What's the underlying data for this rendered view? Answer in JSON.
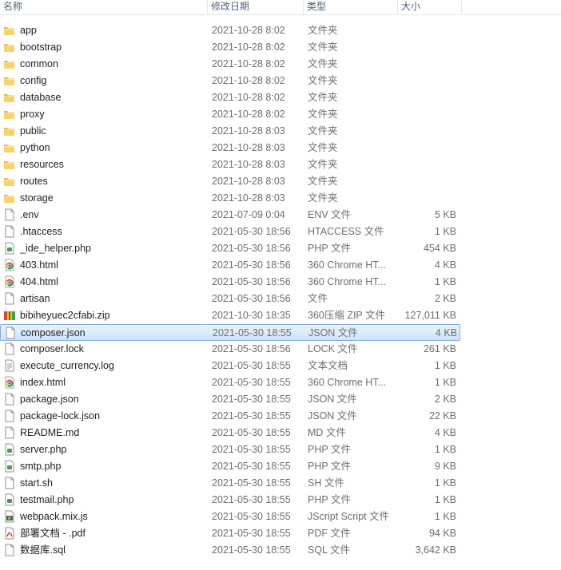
{
  "columns": {
    "name": "名称",
    "date": "修改日期",
    "type": "类型",
    "size": "大小"
  },
  "selected_index": 18,
  "files": [
    {
      "name": "app",
      "date": "2021-10-28 8:02",
      "type": "文件夹",
      "size": "",
      "icon": "folder-icon"
    },
    {
      "name": "bootstrap",
      "date": "2021-10-28 8:02",
      "type": "文件夹",
      "size": "",
      "icon": "folder-icon"
    },
    {
      "name": "common",
      "date": "2021-10-28 8:02",
      "type": "文件夹",
      "size": "",
      "icon": "folder-icon"
    },
    {
      "name": "config",
      "date": "2021-10-28 8:02",
      "type": "文件夹",
      "size": "",
      "icon": "folder-icon"
    },
    {
      "name": "database",
      "date": "2021-10-28 8:02",
      "type": "文件夹",
      "size": "",
      "icon": "folder-icon"
    },
    {
      "name": "proxy",
      "date": "2021-10-28 8:02",
      "type": "文件夹",
      "size": "",
      "icon": "folder-icon"
    },
    {
      "name": "public",
      "date": "2021-10-28 8:03",
      "type": "文件夹",
      "size": "",
      "icon": "folder-icon"
    },
    {
      "name": "python",
      "date": "2021-10-28 8:03",
      "type": "文件夹",
      "size": "",
      "icon": "folder-icon"
    },
    {
      "name": "resources",
      "date": "2021-10-28 8:03",
      "type": "文件夹",
      "size": "",
      "icon": "folder-icon"
    },
    {
      "name": "routes",
      "date": "2021-10-28 8:03",
      "type": "文件夹",
      "size": "",
      "icon": "folder-icon"
    },
    {
      "name": "storage",
      "date": "2021-10-28 8:03",
      "type": "文件夹",
      "size": "",
      "icon": "folder-icon"
    },
    {
      "name": ".env",
      "date": "2021-07-09 0:04",
      "type": "ENV 文件",
      "size": "5 KB",
      "icon": "file-icon"
    },
    {
      "name": ".htaccess",
      "date": "2021-05-30 18:56",
      "type": "HTACCESS 文件",
      "size": "1 KB",
      "icon": "file-icon"
    },
    {
      "name": "_ide_helper.php",
      "date": "2021-05-30 18:56",
      "type": "PHP 文件",
      "size": "454 KB",
      "icon": "php-file-icon"
    },
    {
      "name": "403.html",
      "date": "2021-05-30 18:56",
      "type": "360 Chrome HT...",
      "size": "4 KB",
      "icon": "chrome-html-icon"
    },
    {
      "name": "404.html",
      "date": "2021-05-30 18:56",
      "type": "360 Chrome HT...",
      "size": "1 KB",
      "icon": "chrome-html-icon"
    },
    {
      "name": "artisan",
      "date": "2021-05-30 18:56",
      "type": "文件",
      "size": "2 KB",
      "icon": "file-icon"
    },
    {
      "name": "bibiheyuec2cfabi.zip",
      "date": "2021-10-30 18:35",
      "type": "360压缩 ZIP 文件",
      "size": "127,011 KB",
      "icon": "zip-archive-icon"
    },
    {
      "name": "composer.json",
      "date": "2021-05-30 18:55",
      "type": "JSON 文件",
      "size": "4 KB",
      "icon": "file-icon"
    },
    {
      "name": "composer.lock",
      "date": "2021-05-30 18:56",
      "type": "LOCK 文件",
      "size": "261 KB",
      "icon": "file-icon"
    },
    {
      "name": "execute_currency.log",
      "date": "2021-05-30 18:55",
      "type": "文本文档",
      "size": "1 KB",
      "icon": "text-file-icon"
    },
    {
      "name": "index.html",
      "date": "2021-05-30 18:55",
      "type": "360 Chrome HT...",
      "size": "1 KB",
      "icon": "chrome-html-icon"
    },
    {
      "name": "package.json",
      "date": "2021-05-30 18:55",
      "type": "JSON 文件",
      "size": "2 KB",
      "icon": "file-icon"
    },
    {
      "name": "package-lock.json",
      "date": "2021-05-30 18:55",
      "type": "JSON 文件",
      "size": "22 KB",
      "icon": "file-icon"
    },
    {
      "name": "README.md",
      "date": "2021-05-30 18:55",
      "type": "MD 文件",
      "size": "4 KB",
      "icon": "file-icon"
    },
    {
      "name": "server.php",
      "date": "2021-05-30 18:55",
      "type": "PHP 文件",
      "size": "1 KB",
      "icon": "php-file-icon"
    },
    {
      "name": "smtp.php",
      "date": "2021-05-30 18:55",
      "type": "PHP 文件",
      "size": "9 KB",
      "icon": "php-file-icon"
    },
    {
      "name": "start.sh",
      "date": "2021-05-30 18:55",
      "type": "SH 文件",
      "size": "1 KB",
      "icon": "file-icon"
    },
    {
      "name": "testmail.php",
      "date": "2021-05-30 18:55",
      "type": "PHP 文件",
      "size": "1 KB",
      "icon": "php-file-icon"
    },
    {
      "name": "webpack.mix.js",
      "date": "2021-05-30 18:55",
      "type": "JScript Script 文件",
      "size": "1 KB",
      "icon": "script-file-icon"
    },
    {
      "name": "部署文档 - .pdf",
      "date": "2021-05-30 18:55",
      "type": "PDF 文件",
      "size": "94 KB",
      "icon": "pdf-file-icon"
    },
    {
      "name": "数据库.sql",
      "date": "2021-05-30 18:55",
      "type": "SQL 文件",
      "size": "3,642 KB",
      "icon": "file-icon"
    }
  ]
}
